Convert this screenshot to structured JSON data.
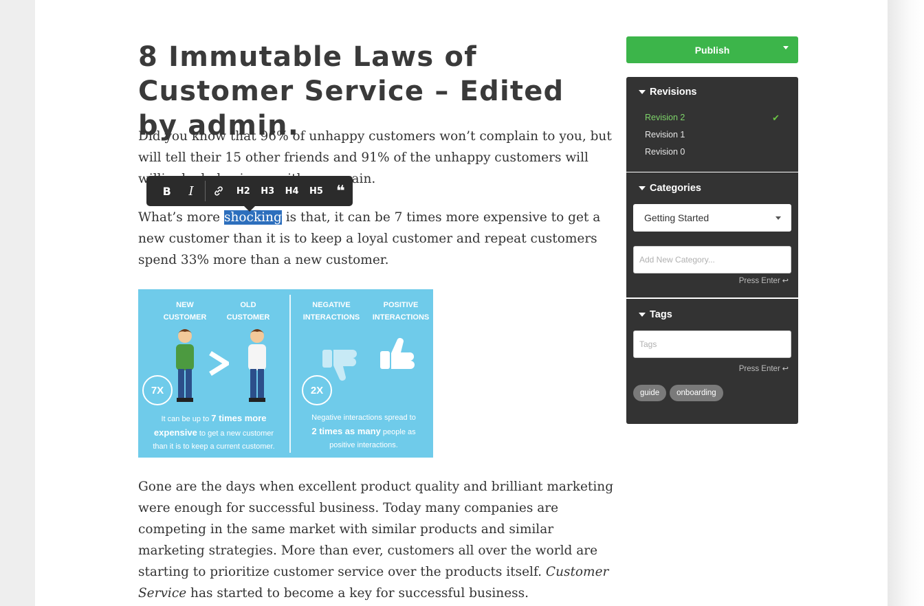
{
  "article": {
    "title": "8 Immutable Laws of Customer Service – Edited by admin.",
    "p1": "Did you know that 96% of unhappy customers won’t complain to you, but will tell their 15 other friends and 91%  of the unhappy customers will never",
    "p1_partial": "willingly do business with you again.",
    "p2_before": "What’s more ",
    "p2_selected": "shocking",
    "p2_after": " is that, it can be 7 times more expensive to get a new customer than it is to keep a loyal customer and repeat customers spend 33% more than a new customer.",
    "p3_before": "Gone are the days when excellent product quality and brilliant marketing were enough for successful business. Today many companies are competing in the same market with similar products and similar marketing strategies. More than ever, customers all over the world are starting to prioritize customer service over the products itself. ",
    "p3_em": "Customer Service",
    "p3_after": " has started to become a key for successful business."
  },
  "toolbar": {
    "bold": "B",
    "italic": "I",
    "link_icon": "link-icon",
    "h2": "H2",
    "h3": "H3",
    "h4": "H4",
    "h5": "H5",
    "quote": "❝"
  },
  "infographic": {
    "new_customer": "NEW\nCUSTOMER",
    "old_customer": "OLD\nCUSTOMER",
    "negative": "NEGATIVE\nINTERACTIONS",
    "positive": "POSITIVE\nINTERACTIONS",
    "badge_left": "7X",
    "badge_right": "2X",
    "cap_left_1": "It can be up to ",
    "cap_left_b1": "7 times more",
    "cap_left_b2": "expensive",
    "cap_left_2": " to get a new customer",
    "cap_left_3": "than it is to keep a current customer.",
    "cap_right_1": "Negative interactions spread to",
    "cap_right_b": "2 times as many",
    "cap_right_2": " people as",
    "cap_right_3": "positive interactions.",
    "bg_color": "#6fcbea"
  },
  "sidebar": {
    "publish_label": "Publish",
    "publish_color": "#3cb54a",
    "revisions": {
      "title": "Revisions",
      "items": [
        {
          "label": "Revision 2",
          "active": true
        },
        {
          "label": "Revision 1",
          "active": false
        },
        {
          "label": "Revision 0",
          "active": false
        }
      ]
    },
    "categories": {
      "title": "Categories",
      "selected": "Getting Started",
      "new_placeholder": "Add New Category...",
      "hint": "Press Enter"
    },
    "tags": {
      "title": "Tags",
      "placeholder": "Tags",
      "hint": "Press Enter",
      "items": [
        "guide",
        "onboarding"
      ]
    }
  }
}
